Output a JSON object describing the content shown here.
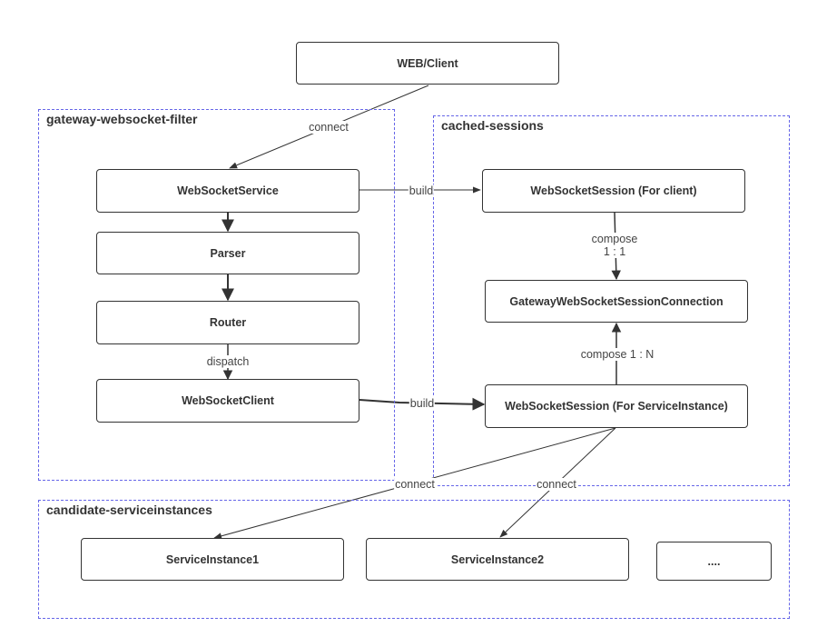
{
  "diagram": {
    "colors": {
      "group_border": "#6666e8",
      "node_border": "#333333",
      "text": "#333333",
      "edge": "#333333"
    },
    "groups": {
      "gateway": {
        "title": "gateway-websocket-filter"
      },
      "cached": {
        "title": "cached-sessions"
      },
      "candidates": {
        "title": "candidate-serviceinstances"
      }
    },
    "nodes": {
      "web_client": "WEB/Client",
      "websocket_service": "WebSocketService",
      "parser": "Parser",
      "router": "Router",
      "websocket_client": "WebSocketClient",
      "session_for_client": "WebSocketSession (For client)",
      "session_connection": "GatewayWebSocketSessionConnection",
      "session_for_instance": "WebSocketSession (For ServiceInstance)",
      "service_instance_1": "ServiceInstance1",
      "service_instance_2": "ServiceInstance2",
      "more": "...."
    },
    "edges": {
      "client_connect": "connect",
      "service_build": "build",
      "compose_1_1_line1": "compose",
      "compose_1_1_line2": "1 : 1",
      "router_dispatch": "dispatch",
      "compose_1_n": "compose 1 : N",
      "client_build": "build",
      "instance1_connect": "connect",
      "instance2_connect": "connect"
    }
  }
}
